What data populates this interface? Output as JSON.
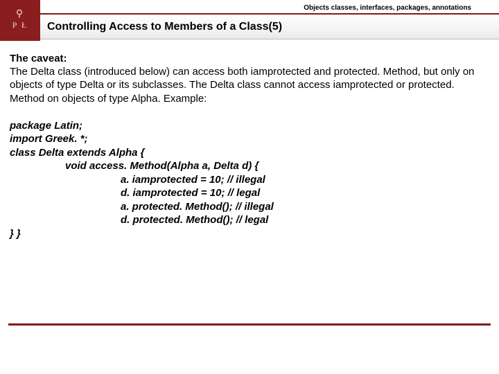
{
  "header": {
    "topic": "Objects classes, interfaces, packages, annotations",
    "title": "Controlling Access to Members of a Class(5)",
    "logo_letters": "P   Ł",
    "logo_symbol": "⚲"
  },
  "caveat": {
    "heading": "The caveat:",
    "body": "The Delta class (introduced below) can access both iamprotected and protected. Method, but only on objects of type Delta or its subclasses. The Delta class cannot access iamprotected or protected. Method on objects of type Alpha. Example:"
  },
  "code": {
    "l1": "package Latin;",
    "l2": "import Greek. *;",
    "l3": "class Delta extends Alpha {",
    "l4": "void access. Method(Alpha a, Delta d) {",
    "l5": "a. iamprotected = 10; // illegal",
    "l6": "d. iamprotected = 10; // legal",
    "l7": "a. protected. Method(); // illegal",
    "l8": "d. protected. Method(); // legal",
    "l9": "} }"
  }
}
